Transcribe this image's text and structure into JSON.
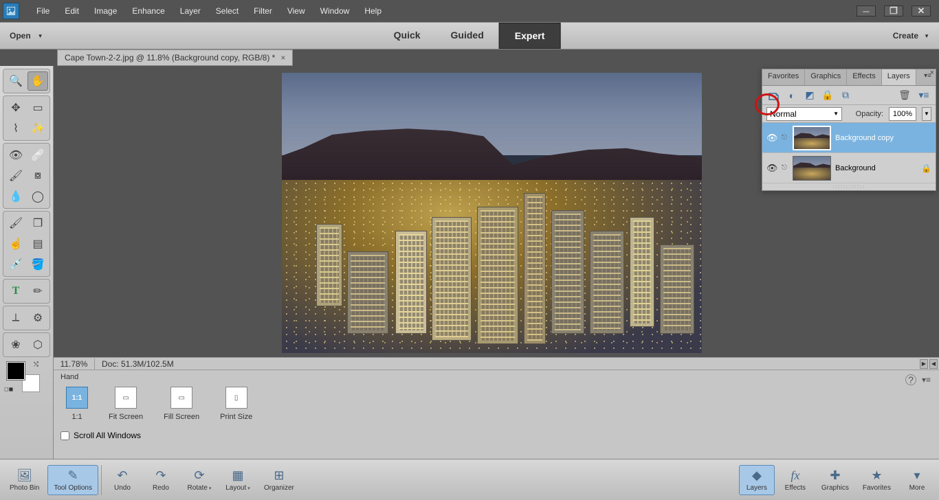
{
  "menubar": [
    "File",
    "Edit",
    "Image",
    "Enhance",
    "Layer",
    "Select",
    "Filter",
    "View",
    "Window",
    "Help"
  ],
  "modebar": {
    "open": "Open",
    "modes": [
      "Quick",
      "Guided",
      "Expert"
    ],
    "active_mode": "Expert",
    "create": "Create"
  },
  "doc_tab": "Cape Town-2-2.jpg @ 11.8% (Background copy, RGB/8) *",
  "status": {
    "zoom": "11.78%",
    "doc": "Doc: 51.3M/102.5M"
  },
  "options": {
    "tool_name": "Hand",
    "buttons": [
      {
        "label": "1:1",
        "icon": "1:1",
        "active": true
      },
      {
        "label": "Fit Screen",
        "icon": "▭"
      },
      {
        "label": "Fill Screen",
        "icon": "▭"
      },
      {
        "label": "Print Size",
        "icon": "▯"
      }
    ],
    "scroll_all": "Scroll All Windows"
  },
  "panel": {
    "tabs": [
      "Favorites",
      "Graphics",
      "Effects",
      "Layers"
    ],
    "active_tab": "Layers",
    "blend": "Normal",
    "opacity_label": "Opacity:",
    "opacity_value": "100%",
    "layers": [
      {
        "name": "Background copy",
        "selected": true,
        "locked": false
      },
      {
        "name": "Background",
        "selected": false,
        "locked": true
      }
    ]
  },
  "bottombar": {
    "left": [
      {
        "label": "Photo Bin",
        "icon": "🖼"
      },
      {
        "label": "Tool Options",
        "icon": "✎",
        "active": true
      }
    ],
    "history": [
      {
        "label": "Undo",
        "icon": "↶"
      },
      {
        "label": "Redo",
        "icon": "↷"
      },
      {
        "label": "Rotate",
        "icon": "⟳"
      },
      {
        "label": "Layout",
        "icon": "▦"
      },
      {
        "label": "Organizer",
        "icon": "⊞"
      }
    ],
    "right": [
      {
        "label": "Layers",
        "icon": "◆",
        "active": true
      },
      {
        "label": "Effects",
        "icon": "fx"
      },
      {
        "label": "Graphics",
        "icon": "✚"
      },
      {
        "label": "Favorites",
        "icon": "★"
      },
      {
        "label": "More",
        "icon": "▾"
      }
    ]
  },
  "tools": [
    [
      "zoom",
      "hand"
    ],
    [
      "move",
      "rect-marquee",
      "lasso",
      "magic-wand"
    ],
    [
      "redeye",
      "healing",
      "brush-sel",
      "stamp",
      "blur",
      "sponge"
    ],
    [
      "brush",
      "eraser",
      "smudge",
      "gradient",
      "eyedropper",
      "bucket"
    ],
    [
      "text",
      "pencil"
    ],
    [
      "crop",
      "cookie"
    ],
    [
      "shape",
      "custom"
    ]
  ]
}
